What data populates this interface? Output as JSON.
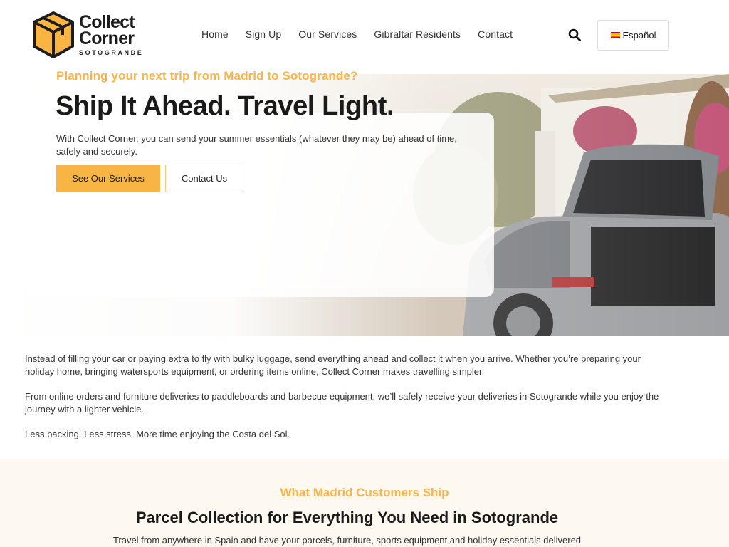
{
  "logo": {
    "line1": "Collect",
    "line2": "Corner",
    "sub": "SOTOGRANDE"
  },
  "nav": {
    "items": [
      {
        "label": "Home"
      },
      {
        "label": "Sign Up"
      },
      {
        "label": "Our Services"
      },
      {
        "label": "Gibraltar Residents"
      },
      {
        "label": "Contact"
      }
    ]
  },
  "header": {
    "search_icon": "search-icon",
    "language": "Español",
    "flag_icon": "spain-flag-icon"
  },
  "hero": {
    "kicker": "Planning your next trip from Madrid to Sotogrande?",
    "title": "Ship It Ahead. Travel Light.",
    "description": "With Collect Corner, you can send your summer essentials (whatever they may be) ahead of time, safely and securely.",
    "primary_button": "See Our Services",
    "secondary_button": "Contact Us"
  },
  "intro": {
    "paragraphs": [
      "Instead of filling your car or paying extra to fly with bulky luggage, send everything ahead and collect it when you arrive. Whether you’re preparing your holiday home, bringing watersports equipment, or ordering items online, Collect Corner makes travelling simpler.",
      "From online orders and furniture deliveries to paddleboards and barbecue equipment, we’ll safely receive your deliveries in Sotogrande while you enjoy the journey with a lighter vehicle.",
      "Less packing. Less stress. More time enjoying the Costa del Sol."
    ]
  },
  "section2": {
    "kicker": "What Madrid Customers Ship",
    "title": "Parcel Collection for Everything You Need in Sotogrande",
    "description": "Travel from anywhere in Spain and have your parcels, furniture, sports equipment and holiday essentials delivered"
  },
  "colors": {
    "accent": "#f9b544",
    "accent_text": "#f7b54a",
    "section_bg": "#fdf8f0"
  }
}
